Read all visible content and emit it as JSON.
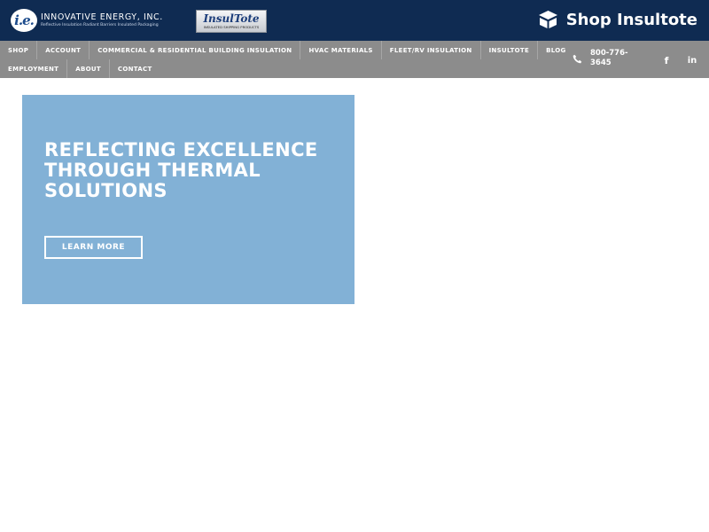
{
  "header": {
    "logo": {
      "monogram": "i.e.",
      "name": "INNOVATIVE ENERGY, INC.",
      "tagline": "Reflective Insulation Radiant Barriers Insulated Packaging"
    },
    "insultote_logo": {
      "brand": "InsulTote",
      "subtitle": "INSULATED SHIPPING PRODUCTS"
    },
    "shop_link": {
      "label": "Shop Insultote",
      "icon": "box-icon"
    }
  },
  "nav": {
    "row1": [
      "SHOP",
      "ACCOUNT",
      "COMMERCIAL & RESIDENTIAL BUILDING INSULATION",
      "HVAC MATERIALS",
      "FLEET/RV INSULATION",
      "INSULTOTE",
      "BLOG"
    ],
    "row2": [
      "EMPLOYMENT",
      "ABOUT",
      "CONTACT"
    ],
    "phone": {
      "icon": "phone-icon",
      "number": "800-776-3645"
    },
    "social": [
      {
        "icon": "facebook-icon",
        "glyph": "f"
      },
      {
        "icon": "linkedin-icon",
        "glyph": "in"
      }
    ]
  },
  "hero": {
    "title": "REFLECTING EXCELLENCE THROUGH THERMAL SOLUTIONS",
    "button_label": "LEARN MORE",
    "background_color": "#82b1d6"
  },
  "colors": {
    "header_bg": "#0f2b52",
    "nav_bg": "#8c8c8c",
    "text_light": "#ffffff"
  }
}
